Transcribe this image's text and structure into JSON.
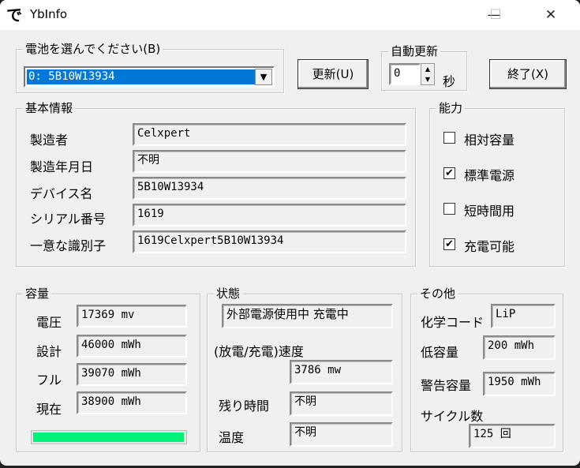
{
  "window": {
    "title": "YbInfo",
    "logo": "で",
    "minimize": "—",
    "maximize": "☐",
    "close": "✕"
  },
  "battery_select": {
    "label": "電池を選んでください(B)",
    "value": "0: 5B10W13934"
  },
  "refresh_button": "更新(U)",
  "auto_refresh": {
    "label": "自動更新",
    "value": "0",
    "unit": "秒"
  },
  "exit_button": "終了(X)",
  "basic_info": {
    "label": "基本情報",
    "rows": [
      {
        "label": "製造者",
        "value": "Celxpert"
      },
      {
        "label": "製造年月日",
        "value": "不明"
      },
      {
        "label": "デバイス名",
        "value": "5B10W13934"
      },
      {
        "label": "シリアル番号",
        "value": " 1619"
      },
      {
        "label": "一意な識別子",
        "value": " 1619Celxpert5B10W13934"
      }
    ]
  },
  "capability": {
    "label": "能力",
    "items": [
      {
        "label": "相対容量",
        "checked": false
      },
      {
        "label": "標準電源",
        "checked": true
      },
      {
        "label": "短時間用",
        "checked": false
      },
      {
        "label": "充電可能",
        "checked": true
      }
    ]
  },
  "capacity": {
    "label": "容量",
    "rows": [
      {
        "label": "電圧",
        "value": "17369 mv"
      },
      {
        "label": "設計",
        "value": "46000 mWh"
      },
      {
        "label": "フル",
        "value": "39070 mWh"
      },
      {
        "label": "現在",
        "value": "38900 mWh"
      }
    ],
    "level_percent": 99.6,
    "bar_color": "#00f07a"
  },
  "status": {
    "label": "状態",
    "state": "外部電源使用中 充電中",
    "rate_label": "(放電/充電)速度",
    "rate": "3786 mw",
    "remaining_label": "残り時間",
    "remaining": "不明",
    "temp_label": "温度",
    "temp": "不明"
  },
  "other": {
    "label": "その他",
    "chem_label": "化学コード",
    "chem": "LiP",
    "low_label": "低容量",
    "low": "200 mWh",
    "warn_label": "警告容量",
    "warn": "1950 mWh",
    "cycle_label": "サイクル数",
    "cycle": "125 回"
  }
}
